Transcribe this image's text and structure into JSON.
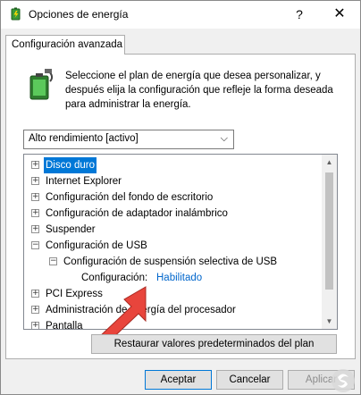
{
  "window": {
    "title": "Opciones de energía",
    "help_label": "?",
    "close_label": "✕"
  },
  "tab": {
    "label": "Configuración avanzada"
  },
  "intro": {
    "text": "Seleccione el plan de energía que desea personalizar, y después elija la configuración que refleje la forma deseada para administrar la energía."
  },
  "plan_select": {
    "value": "Alto rendimiento [activo]"
  },
  "tree": {
    "items": [
      {
        "label": "Disco duro",
        "expander": "+"
      },
      {
        "label": "Internet Explorer",
        "expander": "+"
      },
      {
        "label": "Configuración del fondo de escritorio",
        "expander": "+"
      },
      {
        "label": "Configuración de adaptador inalámbrico",
        "expander": "+"
      },
      {
        "label": "Suspender",
        "expander": "+"
      },
      {
        "label": "Configuración de USB",
        "expander": "−"
      },
      {
        "label": "Configuración de suspensión selectiva de USB",
        "expander": "−"
      },
      {
        "label": "Configuración:",
        "value": "Habilitado"
      },
      {
        "label": "PCI Express",
        "expander": "+"
      },
      {
        "label": "Administración de energía del procesador",
        "expander": "+"
      },
      {
        "label": "Pantalla",
        "expander": "+"
      }
    ]
  },
  "buttons": {
    "restore": "Restaurar valores predeterminados del plan",
    "ok": "Aceptar",
    "cancel": "Cancelar",
    "apply": "Aplicar"
  },
  "colors": {
    "selection": "#0078d7",
    "link": "#0066cc",
    "annotation_arrow": "#e8453c"
  },
  "icons": [
    "power-options-icon",
    "battery-plan-icon",
    "help-icon",
    "close-icon",
    "chevron-down-icon",
    "expand-icon",
    "collapse-icon",
    "scroll-up-icon",
    "scroll-down-icon"
  ]
}
